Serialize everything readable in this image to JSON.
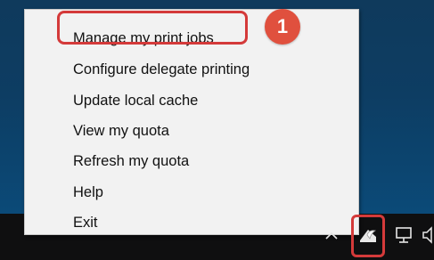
{
  "menu": {
    "items": [
      {
        "label": "Manage my print jobs"
      },
      {
        "label": "Configure delegate printing"
      },
      {
        "label": "Update local cache"
      },
      {
        "label": "View my quota"
      },
      {
        "label": "Refresh my quota"
      },
      {
        "label": "Help"
      },
      {
        "label": "Exit"
      }
    ]
  },
  "annotations": {
    "step_badge": "1",
    "accent_color": "#d43a3a"
  },
  "taskbar": {
    "icons": [
      "chevron-up-icon",
      "print-client-icon",
      "network-icon",
      "speaker-icon"
    ]
  }
}
